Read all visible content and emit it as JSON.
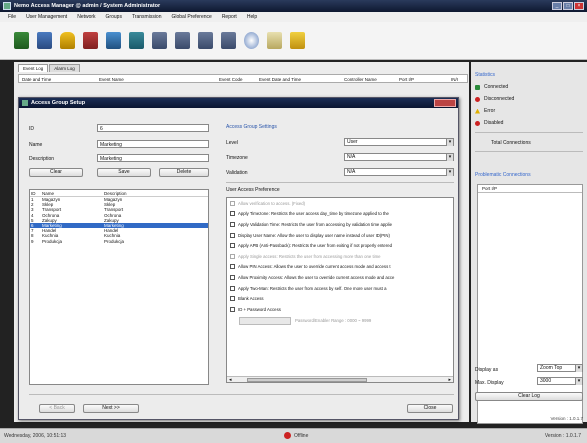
{
  "window": {
    "title": "Nemo Access Manager @ admin / System Administrator"
  },
  "menu": [
    "File",
    "User Management",
    "Network",
    "Groups",
    "Transmission",
    "Global Preference",
    "Report",
    "Help"
  ],
  "toolbar": {
    "icons": [
      "users-icon",
      "user-group-icon",
      "lock-icon",
      "people-icon",
      "network-icon",
      "settings-icon",
      "device-icon",
      "device-icon",
      "device-icon",
      "device-icon",
      "globe-icon",
      "report-icon",
      "export-icon"
    ]
  },
  "main": {
    "tabs": [
      "Event Log",
      "Alarm Log"
    ],
    "log_columns": [
      "Date and Time",
      "Event Name",
      "Event Code",
      "Event Date and Time",
      "Controller Name",
      "Port I/P",
      "IN/I"
    ]
  },
  "right": {
    "statistics_title": "Statistics",
    "stats": [
      {
        "label": "Connected",
        "icon": "connected-icon",
        "color": "#2a8a3a"
      },
      {
        "label": "Disconnected",
        "icon": "disconnected-icon",
        "color": "#cc2222"
      },
      {
        "label": "Error",
        "icon": "warning-icon",
        "color": "#e0b000"
      },
      {
        "label": "Disabled",
        "icon": "disabled-icon",
        "color": "#cc2222"
      }
    ],
    "total_connections": "Total Connections",
    "problematic_title": "Problematic Connections",
    "port_header": "Port I/P",
    "display_as_label": "Display as",
    "display_as_value": "Zoom Top",
    "max_display_label": "Max. Display",
    "max_display_value": "3000",
    "clear_log": "Clear Log",
    "version": "Version : 1.0.1.7"
  },
  "status": {
    "left": "Wednesday, 2006, 10:51:13",
    "center": "Offline",
    "right": "Version : 1.0.1.7"
  },
  "dialog": {
    "title": "Access Group Setup",
    "id_label": "ID",
    "id_value": "6",
    "name_label": "Name",
    "name_value": "Marketing",
    "desc_label": "Description",
    "desc_value": "Marketing",
    "buttons": {
      "clear": "Clear",
      "save": "Save",
      "delete": "Delete",
      "back": "< Back",
      "next": "Next >>",
      "close": "Close"
    },
    "list_columns": [
      "ID",
      "Name",
      "Description"
    ],
    "groups": [
      {
        "id": "1",
        "name": "Magazyn",
        "desc": "Magazyn"
      },
      {
        "id": "2",
        "name": "Sklep",
        "desc": "Sklep"
      },
      {
        "id": "3",
        "name": "Transport",
        "desc": "Transport"
      },
      {
        "id": "4",
        "name": "Ochrona",
        "desc": "Ochrona"
      },
      {
        "id": "5",
        "name": "Zakupy",
        "desc": "Zakupy"
      },
      {
        "id": "6",
        "name": "Marketing",
        "desc": "Marketing"
      },
      {
        "id": "7",
        "name": "Handel",
        "desc": "Handel"
      },
      {
        "id": "8",
        "name": "Kuchnia",
        "desc": "Kuchnia"
      },
      {
        "id": "9",
        "name": "Produkcja",
        "desc": "Produkcja"
      }
    ],
    "settings_title": "Access Group Settings",
    "level_label": "Level",
    "level_value": "User",
    "timezone_label": "Timezone",
    "timezone_value": "N/A",
    "validation_label": "Validation",
    "validation_value": "N/A",
    "preference_title": "User Access Preference",
    "prefs": [
      {
        "text": "Allow verification to access. (Fixed)",
        "dim": true
      },
      {
        "text": "Apply Timezone: Restricts the user access day_time by timezone applied to the",
        "dim": false
      },
      {
        "text": "Apply Validation Time: Restricts the user from accessing by validation time applie",
        "dim": false
      },
      {
        "text": "Display User Name: Allow the user to display user name instead of user ID(PIN)",
        "dim": false
      },
      {
        "text": "Apply APB (Anti-Passback): Restricts the user from exiting if not properly entered",
        "dim": false
      },
      {
        "text": "Apply Single access: Restricts the user from accessing more than one time",
        "dim": true
      },
      {
        "text": "Allow PIN Access: Allows the user to override current access mode and access t",
        "dim": false
      },
      {
        "text": "Allow Proximity Access: Allows the user to override current access mode and acce",
        "dim": false
      },
      {
        "text": "Apply Two-Man: Restricts the user from access by self. One more user must a",
        "dim": false
      },
      {
        "text": "Blank Access",
        "dim": false
      },
      {
        "text": "ID + Password Access",
        "dim": false
      }
    ],
    "password_hint": "Password/Enabler Range : 0000 ~ 9999"
  }
}
